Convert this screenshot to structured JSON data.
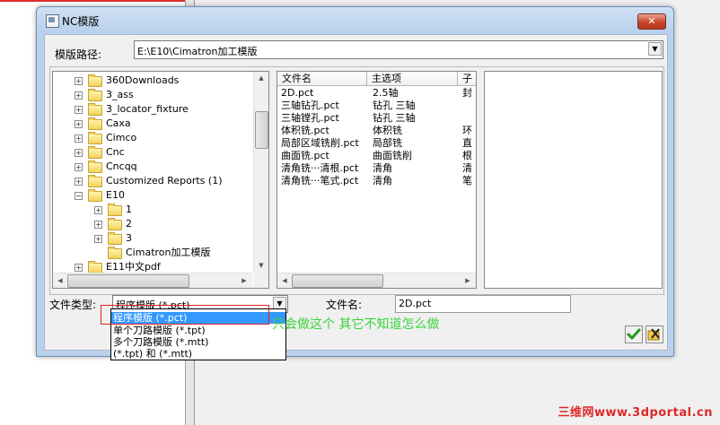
{
  "window": {
    "title": "NC模版",
    "close_glyph": "✕"
  },
  "path": {
    "label": "模版路径:",
    "value": "E:\\E10\\Cimatron加工模版"
  },
  "tree": {
    "items": [
      {
        "label": "360Downloads",
        "level": 0,
        "expander": "+"
      },
      {
        "label": "3_ass",
        "level": 0,
        "expander": "+"
      },
      {
        "label": "3_locator_fixture",
        "level": 0,
        "expander": "+"
      },
      {
        "label": "Caxa",
        "level": 0,
        "expander": "+"
      },
      {
        "label": "Cimco",
        "level": 0,
        "expander": "+"
      },
      {
        "label": "Cnc",
        "level": 0,
        "expander": "+"
      },
      {
        "label": "Cncqq",
        "level": 0,
        "expander": "+"
      },
      {
        "label": "Customized Reports (1)",
        "level": 0,
        "expander": "+"
      },
      {
        "label": "E10",
        "level": 0,
        "expander": "−"
      },
      {
        "label": "1",
        "level": 1,
        "expander": "+"
      },
      {
        "label": "2",
        "level": 1,
        "expander": "+"
      },
      {
        "label": "3",
        "level": 1,
        "expander": "+"
      },
      {
        "label": "Cimatron加工模版",
        "level": 1,
        "expander": ""
      },
      {
        "label": "E11中文pdf",
        "level": 0,
        "expander": "+"
      }
    ]
  },
  "list": {
    "columns": [
      "文件名",
      "主选项",
      "子"
    ],
    "rows": [
      [
        "2D.pct",
        "2.5轴",
        "封"
      ],
      [
        "三轴钻孔.pct",
        "钻孔 三轴",
        ""
      ],
      [
        "三轴镗孔.pct",
        "钻孔 三轴",
        ""
      ],
      [
        "体积铣.pct",
        "体积铣",
        "环"
      ],
      [
        "局部区域铣削.pct",
        "局部铣",
        "直"
      ],
      [
        "曲面铣.pct",
        "曲面铣削",
        "根"
      ],
      [
        "清角铣···清根.pct",
        "清角",
        "清"
      ],
      [
        "清角铣···笔式.pct",
        "清角",
        "笔"
      ]
    ]
  },
  "file_type": {
    "label": "文件类型:",
    "value": "程序模版 (*.pct)",
    "options": [
      "程序模版 (*.pct)",
      "单个刀路模版 (*.tpt)",
      "多个刀路模版 (*.mtt)",
      "(*.tpt) 和 (*.mtt)"
    ]
  },
  "file_name": {
    "label": "文件名:",
    "value": "2D.pct"
  },
  "annotation": {
    "text": "只会做这个 其它不知道怎么做"
  },
  "watermark": {
    "text": "三维网www.3dportal.cn"
  },
  "colors": {
    "selection": "#3399ff",
    "annotation": "#3ad33a",
    "highlight_box": "#e02020",
    "watermark": "#e02828"
  }
}
